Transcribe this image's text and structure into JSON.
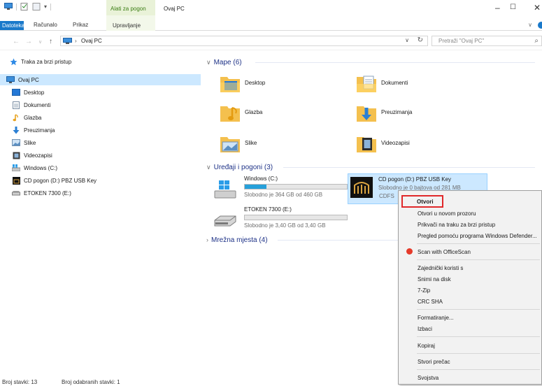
{
  "window": {
    "title": "Ovaj PC",
    "context_tab_title": "Alati za pogon",
    "controls": {
      "minimize": "–",
      "maximize": "☐",
      "close": "✕"
    }
  },
  "ribbon": {
    "tabs": [
      "Datoteka",
      "Računalo",
      "Prikaz",
      "Upravljanje"
    ],
    "collapse_glyph": "∨"
  },
  "address": {
    "back": "←",
    "forward": "→",
    "recent": "∨",
    "up": "↑",
    "separator": "›",
    "location": "Ovaj PC",
    "dropdown": "∨",
    "refresh": "↻",
    "search_placeholder": "Pretraži \"Ovaj PC\"",
    "search_glyph": "⌕"
  },
  "nav": {
    "quick_access": "Traka za brzi pristup",
    "this_pc": "Ovaj PC",
    "items": [
      "Desktop",
      "Dokumenti",
      "Glazba",
      "Preuzimanja",
      "Slike",
      "Videozapisi",
      "Windows (C:)",
      "CD pogon (D:) PBZ USB Key",
      "ETOKEN 7300 (E:)"
    ]
  },
  "content": {
    "groups": {
      "folders": "Mape (6)",
      "drives": "Uređaji i pogoni (3)",
      "network": "Mrežna mjesta (4)"
    },
    "folders": [
      "Desktop",
      "Dokumenti",
      "Glazba",
      "Preuzimanja",
      "Slike",
      "Videozapisi"
    ],
    "drives": [
      {
        "name": "Windows (C:)",
        "free": "Slobodno je 364 GB od 460 GB",
        "used_fraction": 0.21
      },
      {
        "name": "CD pogon (D:) PBZ USB Key",
        "free": "Slobodno je 0 bajtova od 281 MB",
        "fs": "CDFS"
      },
      {
        "name": "ETOKEN 7300 (E:)",
        "free": "Slobodno je 3,40 GB od 3,40 GB",
        "used_fraction": 0.0
      }
    ]
  },
  "context_menu": {
    "items": [
      "Otvori",
      "Otvori u novom prozoru",
      "Prikvači na traku za brzi pristup",
      "Pregled pomoću programa Windows Defender...",
      "Scan with OfficeScan",
      "Zajednički koristi s",
      "Snimi na disk",
      "7-Zip",
      "CRC SHA",
      "Formatiranje...",
      "Izbaci",
      "Kopiraj",
      "Stvori prečac",
      "Svojstva"
    ]
  },
  "status": {
    "items": "Broj stavki: 13",
    "selected": "Broj odabranih stavki: 1"
  },
  "colors": {
    "accent": "#1979ca",
    "selection": "#cce8ff",
    "focus_border": "#e0282a",
    "drive_bar": "#26a0da"
  }
}
